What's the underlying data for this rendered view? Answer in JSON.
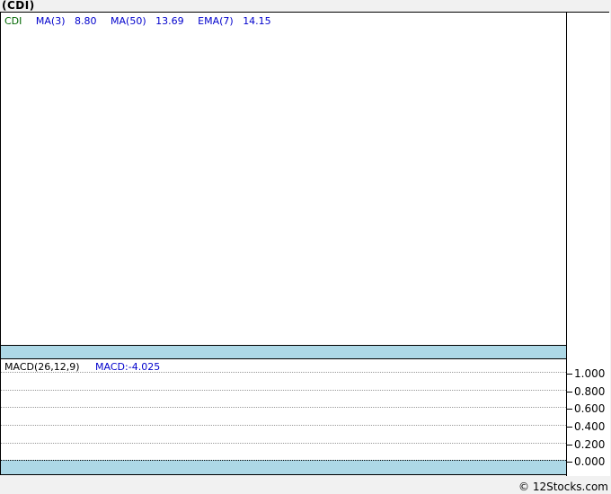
{
  "page": {
    "title": "(CDI)",
    "credit": "© 12Stocks.com"
  },
  "colors": {
    "band_blue": "#add8e6",
    "legend_blue": "#0000cc",
    "symbol_green": "#006600",
    "grid_gray": "#999999",
    "page_gray": "#f1f1f1"
  },
  "main_chart": {
    "legend": {
      "symbol": "CDI",
      "items": [
        {
          "label": "MA(3)",
          "value": "8.80"
        },
        {
          "label": "MA(50)",
          "value": "13.69"
        },
        {
          "label": "EMA(7)",
          "value": "14.15"
        }
      ]
    }
  },
  "macd": {
    "label": "MACD(26,12,9)",
    "value": "MACD:-4.025",
    "axis": [
      "1.000",
      "0.800",
      "0.600",
      "0.400",
      "0.200",
      "0.000"
    ]
  },
  "chart_data": {
    "type": "line",
    "title": "(CDI)",
    "legend_position": "top-left",
    "panels": [
      {
        "name": "price",
        "indicators": [
          {
            "name": "CDI",
            "color": "#006600"
          },
          {
            "name": "MA(3)",
            "last_value": 8.8
          },
          {
            "name": "MA(50)",
            "last_value": 13.69
          },
          {
            "name": "EMA(7)",
            "last_value": 14.15
          }
        ],
        "series": [],
        "note": "price plot area is rendered empty (no visible data points or axis labels)"
      },
      {
        "name": "MACD(26,12,9)",
        "series": [
          {
            "name": "MACD",
            "last_value": -4.025
          }
        ],
        "y_ticks": [
          1.0,
          0.8,
          0.6,
          0.4,
          0.2,
          0.0
        ],
        "ylim": [
          0.0,
          1.1
        ],
        "grid": "horizontal dotted lines at each y tick; zero line dotted black",
        "note": "MACD plot area is rendered empty (no visible curve)"
      }
    ],
    "credit": "© 12Stocks.com"
  }
}
